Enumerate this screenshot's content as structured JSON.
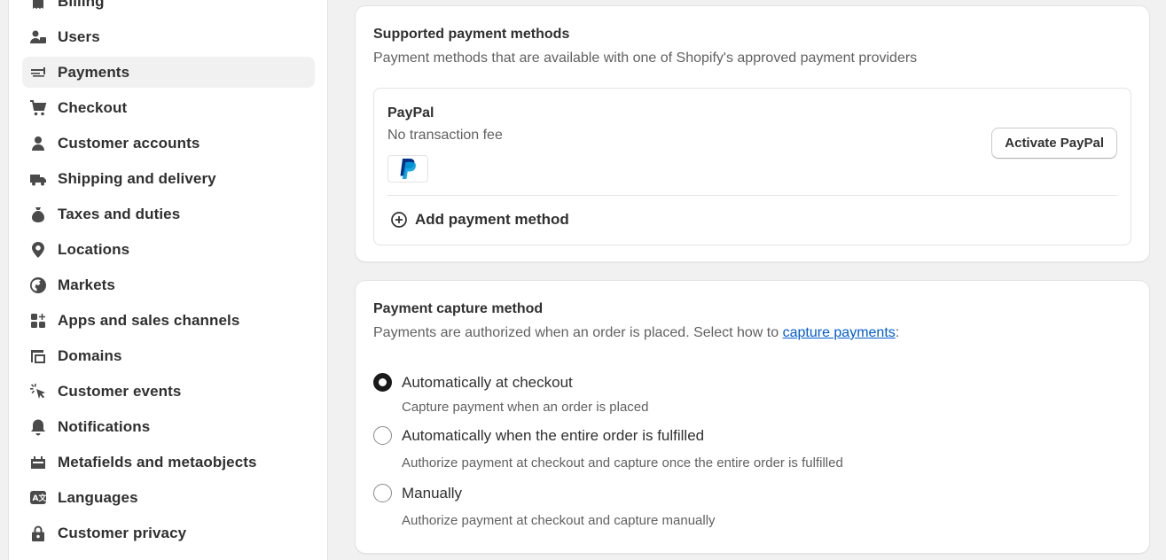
{
  "sidebar": {
    "items": [
      {
        "label": "Billing",
        "icon": "receipt-icon"
      },
      {
        "label": "Users",
        "icon": "users-icon"
      },
      {
        "label": "Payments",
        "icon": "payments-icon"
      },
      {
        "label": "Checkout",
        "icon": "cart-icon"
      },
      {
        "label": "Customer accounts",
        "icon": "person-icon"
      },
      {
        "label": "Shipping and delivery",
        "icon": "truck-icon"
      },
      {
        "label": "Taxes and duties",
        "icon": "tax-icon"
      },
      {
        "label": "Locations",
        "icon": "location-pin-icon"
      },
      {
        "label": "Markets",
        "icon": "globe-icon"
      },
      {
        "label": "Apps and sales channels",
        "icon": "apps-icon"
      },
      {
        "label": "Domains",
        "icon": "domains-icon"
      },
      {
        "label": "Customer events",
        "icon": "cursor-click-icon"
      },
      {
        "label": "Notifications",
        "icon": "bell-icon"
      },
      {
        "label": "Metafields and metaobjects",
        "icon": "metafields-icon"
      },
      {
        "label": "Languages",
        "icon": "language-icon"
      },
      {
        "label": "Customer privacy",
        "icon": "lock-icon"
      }
    ],
    "active": "Payments"
  },
  "supported": {
    "title": "Supported payment methods",
    "subtitle": "Payment methods that are available with one of Shopify's approved payment providers",
    "provider_name": "PayPal",
    "provider_fee": "No transaction fee",
    "provider_logo": "paypal-logo",
    "activate_label": "Activate PayPal",
    "add_label": "Add payment method"
  },
  "capture": {
    "title": "Payment capture method",
    "subtitle_prefix": "Payments are authorized when an order is placed. Select how to ",
    "subtitle_link": "capture payments",
    "subtitle_suffix": ":",
    "options": [
      {
        "label": "Automatically at checkout",
        "help": "Capture payment when an order is placed",
        "checked": true
      },
      {
        "label": "Automatically when the entire order is fulfilled",
        "help": "Authorize payment at checkout and capture once the entire order is fulfilled",
        "checked": false
      },
      {
        "label": "Manually",
        "help": "Authorize payment at checkout and capture manually",
        "checked": false
      }
    ]
  },
  "colors": {
    "link": "#005bd3",
    "active_bg": "#f1f1f1",
    "paypal_dark": "#003087",
    "paypal_light": "#009cde"
  }
}
